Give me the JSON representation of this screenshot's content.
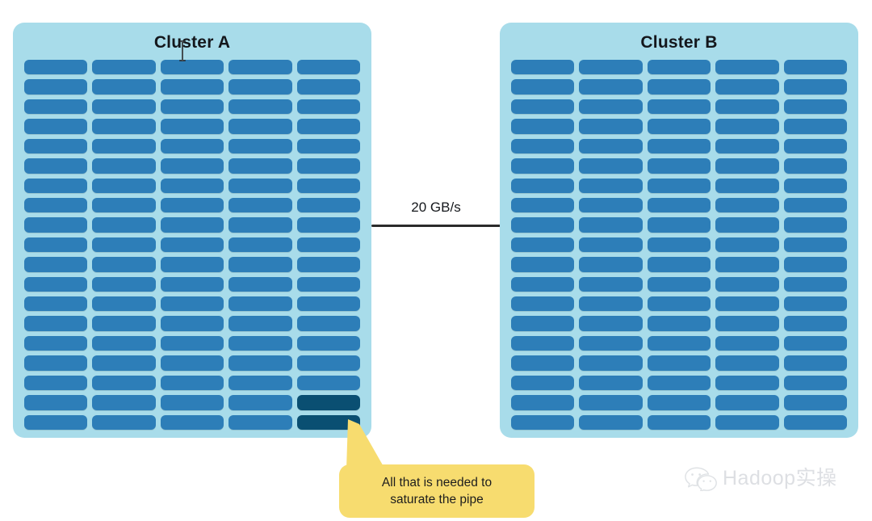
{
  "diagram": {
    "title_cluster_a": "Cluster A",
    "title_cluster_b": "Cluster B",
    "link_label": "20 GB/s",
    "callout": {
      "line1": "All that is needed to",
      "line2": "saturate the pipe"
    },
    "watermark": {
      "text": "Hadoop实操",
      "logo": "wechat-icon"
    },
    "cursor": "text-ibeam-cursor",
    "grid": {
      "columns": 5,
      "rows": 19,
      "cluster_a_total_nodes": 95,
      "cluster_b_total_nodes": 95,
      "highlighted_cells_cluster_a": [
        {
          "row": 18,
          "column": 5
        },
        {
          "row": 19,
          "column": 5
        }
      ]
    },
    "colors": {
      "panel_background": "#a8dcea",
      "node": "#2d7eb8",
      "node_highlighted": "#0a4f72",
      "callout_background": "#f7dc6f",
      "link_line": "#2b2b2b",
      "title_text": "#14171c",
      "page_background": "#ffffff",
      "watermark_text": "#c9cdd2"
    }
  }
}
